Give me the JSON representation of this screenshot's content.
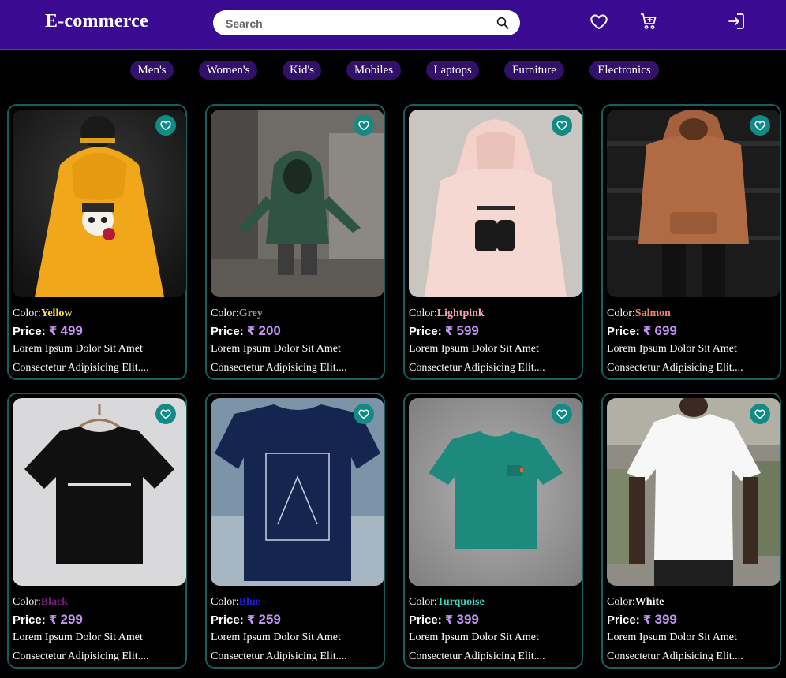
{
  "header": {
    "brand": "E-commerce",
    "search_placeholder": "Search",
    "icons": [
      "heart-icon",
      "cart-icon",
      "login-icon"
    ]
  },
  "nav": [
    "Men's",
    "Women's",
    "Kid's",
    "Mobiles",
    "Laptops",
    "Furniture",
    "Electronics"
  ],
  "product_labels": {
    "color_prefix": "Color:",
    "price_prefix": "Price:",
    "currency": "₹"
  },
  "products": [
    {
      "color": "Yellow",
      "color_hex": "#f7e14b",
      "price": "499",
      "desc1": "Lorem Ipsum Dolor Sit Amet",
      "desc2": "Consectetur Adipisicing Elit....",
      "image": "yellow-hoodie-photo"
    },
    {
      "color": "Grey",
      "color_hex": "#9a9a9a",
      "price": "200",
      "desc1": "Lorem Ipsum Dolor Sit Amet",
      "desc2": "Consectetur Adipisicing Elit....",
      "image": "green-hoodie-street-photo"
    },
    {
      "color": "Lightpink",
      "color_hex": "#f4a4b4",
      "price": "599",
      "desc1": "Lorem Ipsum Dolor Sit Amet",
      "desc2": "Consectetur Adipisicing Elit....",
      "image": "pink-hoodie-photo"
    },
    {
      "color": "Salmon",
      "color_hex": "#f0806f",
      "price": "699",
      "desc1": "Lorem Ipsum Dolor Sit Amet",
      "desc2": "Consectetur Adipisicing Elit....",
      "image": "brown-hoodie-photo"
    },
    {
      "color": "Black",
      "color_hex": "#7a1b7a",
      "price": "299",
      "desc1": "Lorem Ipsum Dolor Sit Amet",
      "desc2": "Consectetur Adipisicing Elit....",
      "image": "black-tshirt-photo"
    },
    {
      "color": "Blue",
      "color_hex": "#1f1fd6",
      "price": "259",
      "desc1": "Lorem Ipsum Dolor Sit Amet",
      "desc2": "Consectetur Adipisicing Elit....",
      "image": "navy-tshirt-photo"
    },
    {
      "color": "Turquoise",
      "color_hex": "#3fd6c8",
      "price": "399",
      "desc1": "Lorem Ipsum Dolor Sit Amet",
      "desc2": "Consectetur Adipisicing Elit....",
      "image": "turquoise-tshirt-photo"
    },
    {
      "color": "White",
      "color_hex": "#ffffff",
      "price": "399",
      "desc1": "Lorem Ipsum Dolor Sit Amet",
      "desc2": "Consectetur Adipisicing Elit....",
      "image": "white-tshirt-photo"
    }
  ],
  "colors": {
    "header_bg": "#3a0b91",
    "pill_bg": "#33116b",
    "card_border": "#175e5e",
    "fav_bg": "#128a86",
    "price_accent": "#c392f5"
  }
}
